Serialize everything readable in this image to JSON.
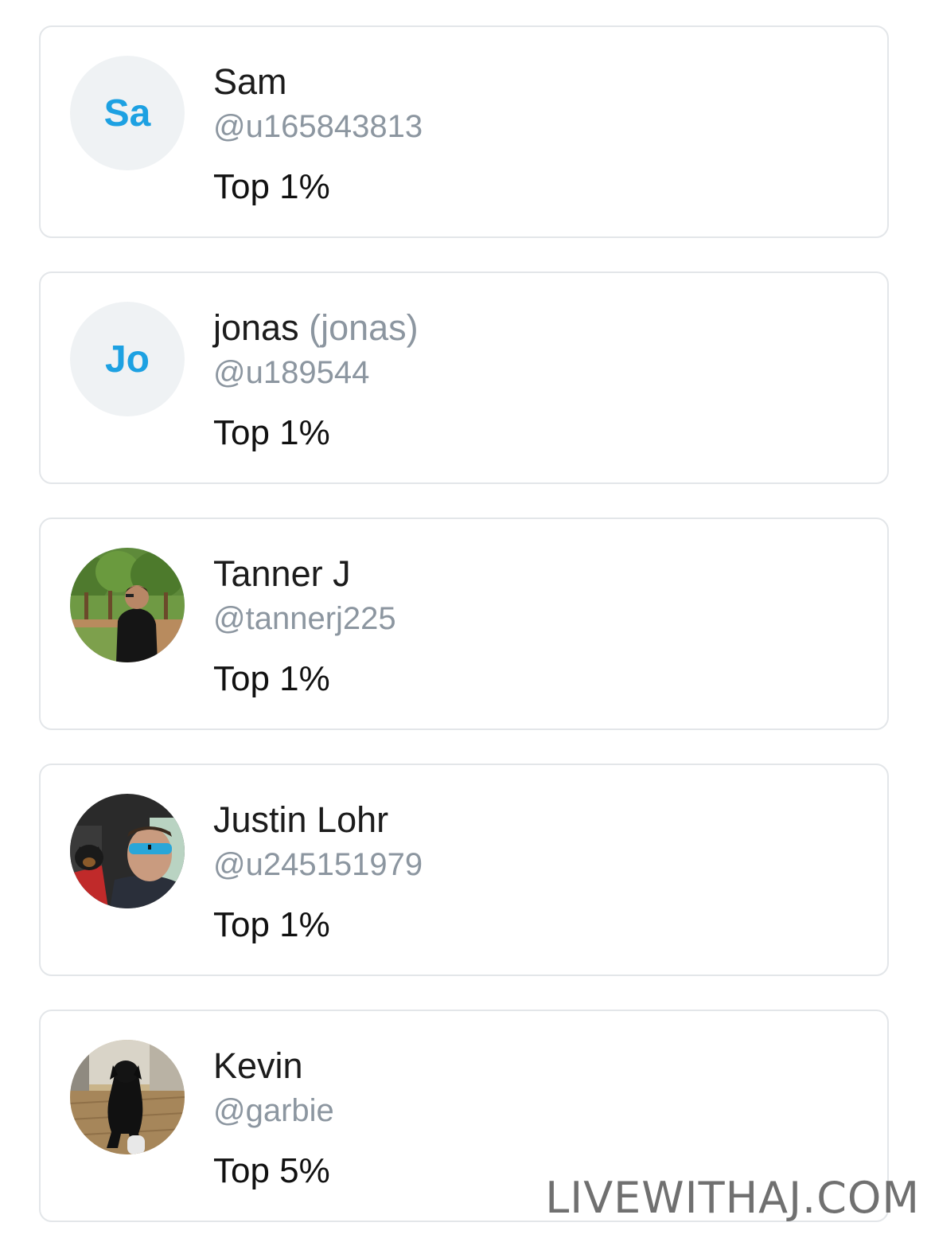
{
  "users": [
    {
      "avatar_type": "initials",
      "initials": "Sa",
      "name": "Sam",
      "alias": "",
      "handle": "@u165843813",
      "rank": "Top 1%"
    },
    {
      "avatar_type": "initials",
      "initials": "Jo",
      "name": "jonas",
      "alias": "(jonas)",
      "handle": "@u189544",
      "rank": "Top 1%"
    },
    {
      "avatar_type": "photo",
      "avatar_icon": "orchard-man-photo",
      "name": "Tanner J",
      "alias": "",
      "handle": "@tannerj225",
      "rank": "Top 1%"
    },
    {
      "avatar_type": "photo",
      "avatar_icon": "car-selfie-dog-photo",
      "name": "Justin Lohr",
      "alias": "",
      "handle": "@u245151979",
      "rank": "Top 1%"
    },
    {
      "avatar_type": "photo",
      "avatar_icon": "black-dog-photo",
      "name": "Kevin",
      "alias": "",
      "handle": "@garbie",
      "rank": "Top 5%"
    }
  ],
  "watermark": "LIVEWITHAJ.COM",
  "colors": {
    "initials_accent": "#1da1e2",
    "initials_bg": "#eff2f4",
    "handle_gray": "#8c96a0",
    "card_border": "#e3e6e9"
  }
}
